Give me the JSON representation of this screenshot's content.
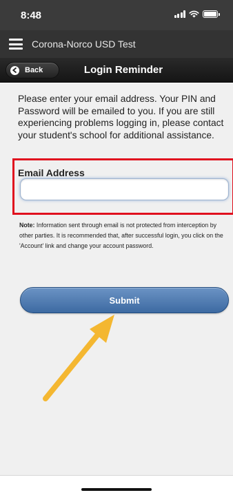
{
  "status_bar": {
    "time": "8:48"
  },
  "app_header": {
    "title": "Corona-Norco USD Test"
  },
  "nav_bar": {
    "back_label": "Back",
    "title": "Login Reminder"
  },
  "content": {
    "intro": "Please enter your email address. Your PIN and Password will be emailed to you. If you are still experiencing problems logging in, please contact your student's school for additional assistance.",
    "email_label": "Email Address",
    "email_value": "",
    "email_placeholder": "",
    "note_prefix": "Note:",
    "note_text": " Information sent through email is not protected from interception by other parties. It is recommended that, after successful login, you click on the 'Account' link and change your account password.",
    "submit_label": "Submit"
  },
  "colors": {
    "highlight_box": "#e0101e",
    "arrow": "#f4b731",
    "submit_button": "#4a76ad"
  },
  "icons": [
    "hamburger-icon",
    "back-arrow-icon",
    "signal-icon",
    "wifi-icon",
    "battery-icon"
  ]
}
